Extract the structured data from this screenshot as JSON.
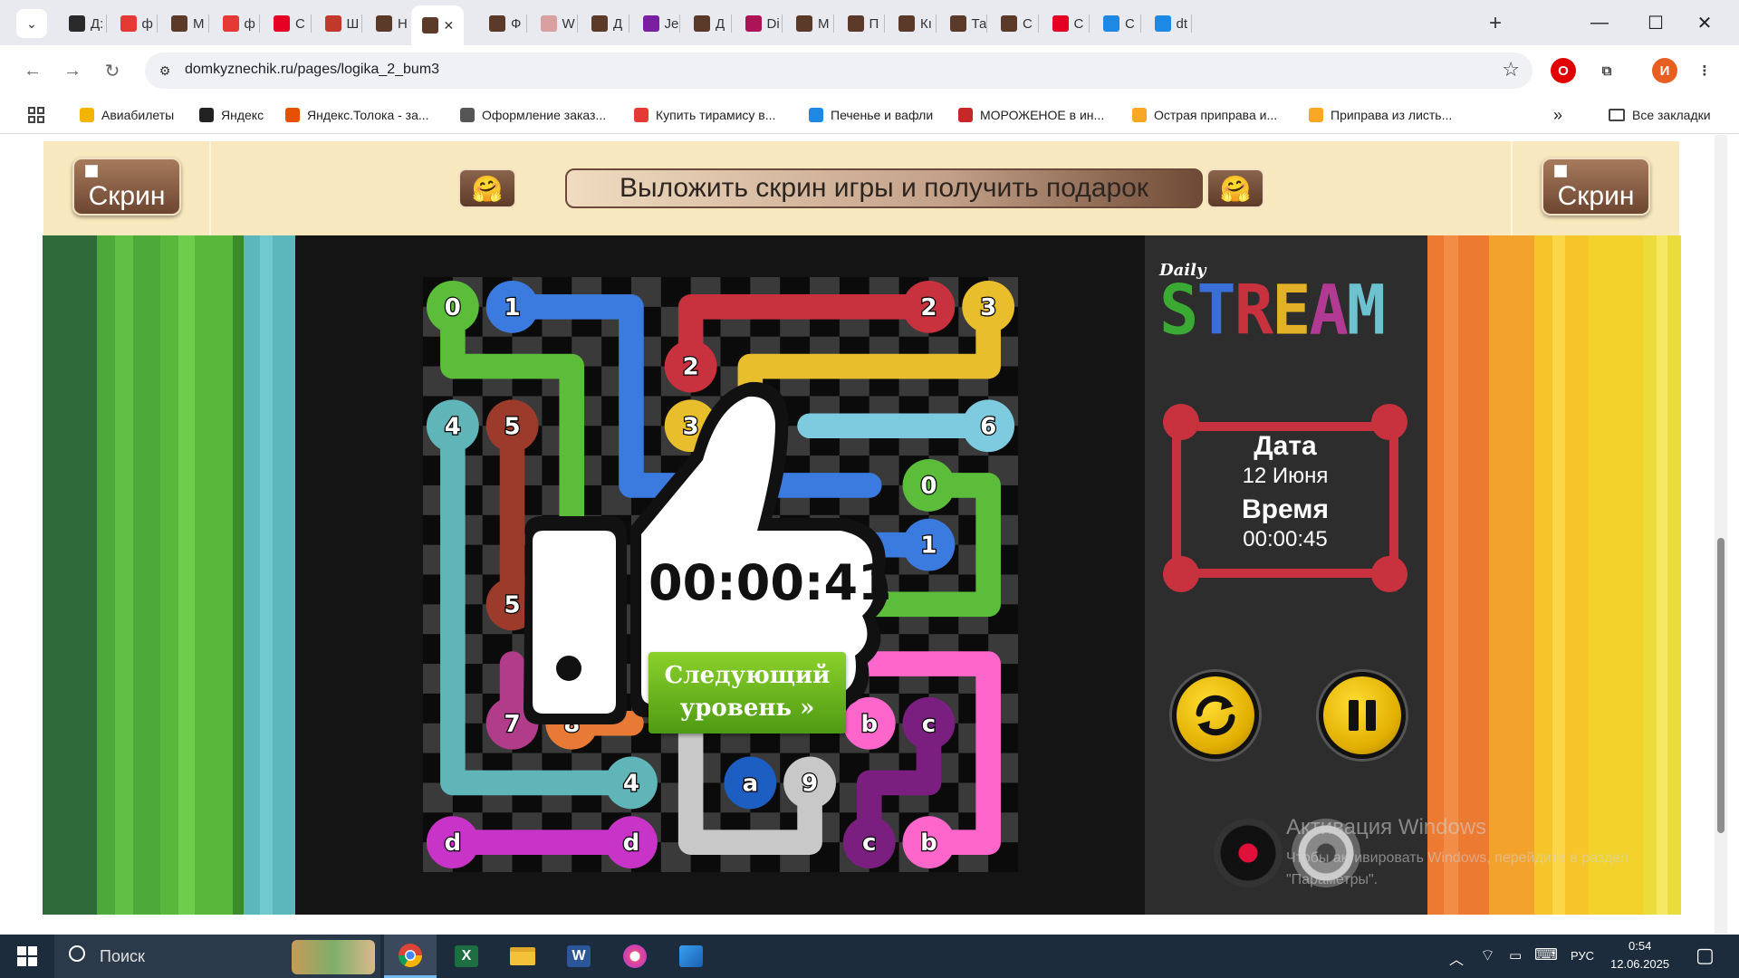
{
  "browser": {
    "tabs": [
      {
        "label": "Д:",
        "color": "#2a2a2a"
      },
      {
        "label": "ф",
        "color": "#e53935"
      },
      {
        "label": "М",
        "color": "#5b3a29"
      },
      {
        "label": "ф",
        "color": "#e53935"
      },
      {
        "label": "С",
        "color": "#e60023"
      },
      {
        "label": "Ш",
        "color": "#c0392b"
      },
      {
        "label": "Н",
        "color": "#5b3a29"
      },
      {
        "label": "",
        "color": "#5b3a29"
      },
      {
        "label": "Ф",
        "color": "#5b3a29"
      },
      {
        "label": "W",
        "color": "#d9a0a0"
      },
      {
        "label": "Д",
        "color": "#5b3a29"
      },
      {
        "label": "Je",
        "color": "#7b1fa2"
      },
      {
        "label": "Д",
        "color": "#5b3a29"
      },
      {
        "label": "Di",
        "color": "#ad1457"
      },
      {
        "label": "М",
        "color": "#5b3a29"
      },
      {
        "label": "П",
        "color": "#5b3a29"
      },
      {
        "label": "Кı",
        "color": "#5b3a29"
      },
      {
        "label": "Та",
        "color": "#5b3a29"
      },
      {
        "label": "С",
        "color": "#5b3a29"
      },
      {
        "label": "С",
        "color": "#e60023"
      },
      {
        "label": "С",
        "color": "#1e88e5"
      },
      {
        "label": "dt",
        "color": "#1e88e5"
      }
    ],
    "active_tab_close": "✕",
    "new_tab": "+",
    "url": "domkyznechik.ru/pages/logika_2_bum3",
    "bookmarks": [
      {
        "label": "Авиабилеты",
        "color": "#f4b400"
      },
      {
        "label": "Яндекс",
        "color": "#222"
      },
      {
        "label": "Яндекс.Толока - за...",
        "color": "#e65100"
      },
      {
        "label": "Оформление заказ...",
        "color": "#555"
      },
      {
        "label": "Купить тирамису в...",
        "color": "#e53935"
      },
      {
        "label": "Печенье и вафли",
        "color": "#1e88e5"
      },
      {
        "label": "МОРОЖЕНОЕ в ин...",
        "color": "#c62828"
      },
      {
        "label": "Острая приправа и...",
        "color": "#f9a825"
      },
      {
        "label": "Приправа из листь...",
        "color": "#f9a825"
      }
    ],
    "bookmarks_more": "»",
    "all_bookmarks": "Все закладки"
  },
  "banner": {
    "screen_left": "Скрин",
    "screen_right": "Скрин",
    "emoji_left": "🤗",
    "emoji_right": "🤗",
    "text": "Выложить скрин игры и получить подарок"
  },
  "game": {
    "logo_small": "Daily",
    "logo_letters": [
      {
        "ch": "S",
        "color": "#3aaa35"
      },
      {
        "ch": "T",
        "color": "#3b6fd8"
      },
      {
        "ch": "R",
        "color": "#c8323e"
      },
      {
        "ch": "E",
        "color": "#e2b127"
      },
      {
        "ch": "A",
        "color": "#b23a93"
      },
      {
        "ch": "M",
        "color": "#6cc2cf"
      }
    ],
    "date_label": "Дата",
    "date_value": "12 Июня",
    "time_label": "Время",
    "time_value": "00:00:45",
    "win_timer": "00:00:41",
    "next_button": "Следующий уровень »",
    "next_line1": "Следующий",
    "next_line2": "уровень »",
    "grid_size": 10,
    "colors": {
      "0": "#5bbd3a",
      "1": "#3b7be0",
      "2": "#c8323e",
      "3": "#e8be2c",
      "4": "#5fb5b8",
      "5": "#9c3a2c",
      "6": "#7ecbe0",
      "7": "#b03c8a",
      "8": "#e87a35",
      "9": "#c8c8c8",
      "a": "#1d5ec2",
      "b": "#ff66cc",
      "c": "#7a1f80",
      "d": "#c833c8"
    },
    "dots": [
      {
        "id": "0",
        "r": 0,
        "c": 0
      },
      {
        "id": "1",
        "r": 0,
        "c": 1
      },
      {
        "id": "2",
        "r": 0,
        "c": 8
      },
      {
        "id": "3",
        "r": 0,
        "c": 9
      },
      {
        "id": "2",
        "r": 1,
        "c": 4
      },
      {
        "id": "4",
        "r": 2,
        "c": 0
      },
      {
        "id": "5",
        "r": 2,
        "c": 1
      },
      {
        "id": "3",
        "r": 2,
        "c": 4
      },
      {
        "id": "6",
        "r": 2,
        "c": 9
      },
      {
        "id": "0",
        "r": 3,
        "c": 8
      },
      {
        "id": "1",
        "r": 4,
        "c": 8
      },
      {
        "id": "5",
        "r": 5,
        "c": 1
      },
      {
        "id": "7",
        "r": 7,
        "c": 1
      },
      {
        "id": "8",
        "r": 7,
        "c": 2
      },
      {
        "id": "b",
        "r": 7,
        "c": 7
      },
      {
        "id": "c",
        "r": 7,
        "c": 8
      },
      {
        "id": "4",
        "r": 8,
        "c": 3
      },
      {
        "id": "a",
        "r": 8,
        "c": 5
      },
      {
        "id": "9",
        "r": 8,
        "c": 6
      },
      {
        "id": "d",
        "r": 9,
        "c": 0
      },
      {
        "id": "d",
        "r": 9,
        "c": 3
      },
      {
        "id": "c",
        "r": 9,
        "c": 7
      },
      {
        "id": "b",
        "r": 9,
        "c": 8
      }
    ],
    "paths": [
      {
        "id": "0",
        "cells": [
          [
            0,
            0
          ],
          [
            1,
            0
          ],
          [
            1,
            2
          ],
          [
            3,
            2
          ],
          [
            4,
            2
          ]
        ]
      },
      {
        "id": "1",
        "cells": [
          [
            0,
            1
          ],
          [
            0,
            3
          ],
          [
            3,
            3
          ],
          [
            3,
            5
          ],
          [
            3,
            7
          ]
        ]
      },
      {
        "id": "2",
        "cells": [
          [
            1,
            4
          ],
          [
            0,
            4
          ],
          [
            0,
            8
          ]
        ]
      },
      {
        "id": "3",
        "cells": [
          [
            0,
            9
          ],
          [
            1,
            9
          ],
          [
            1,
            5
          ],
          [
            2,
            5
          ],
          [
            2,
            4
          ]
        ]
      },
      {
        "id": "4",
        "cells": [
          [
            2,
            0
          ],
          [
            8,
            0
          ],
          [
            8,
            3
          ]
        ]
      },
      {
        "id": "5",
        "cells": [
          [
            2,
            1
          ],
          [
            5,
            1
          ]
        ]
      },
      {
        "id": "6",
        "cells": [
          [
            2,
            9
          ],
          [
            2,
            6
          ]
        ]
      },
      {
        "id": "0",
        "cells": [
          [
            3,
            8
          ],
          [
            3,
            9
          ],
          [
            5,
            9
          ],
          [
            5,
            7
          ]
        ]
      },
      {
        "id": "1",
        "cells": [
          [
            4,
            8
          ],
          [
            4,
            7
          ]
        ]
      },
      {
        "id": "b",
        "cells": [
          [
            6,
            7
          ],
          [
            6,
            9
          ],
          [
            9,
            9
          ],
          [
            9,
            8
          ]
        ]
      },
      {
        "id": "c",
        "cells": [
          [
            7,
            8
          ],
          [
            8,
            8
          ],
          [
            8,
            7
          ],
          [
            9,
            7
          ]
        ]
      },
      {
        "id": "9",
        "cells": [
          [
            7,
            4
          ],
          [
            9,
            4
          ],
          [
            9,
            6
          ],
          [
            8,
            6
          ]
        ]
      },
      {
        "id": "d",
        "cells": [
          [
            9,
            0
          ],
          [
            9,
            3
          ]
        ]
      },
      {
        "id": "7",
        "cells": [
          [
            6,
            1
          ],
          [
            7,
            1
          ]
        ]
      },
      {
        "id": "8",
        "cells": [
          [
            7,
            2
          ],
          [
            7,
            3
          ]
        ]
      }
    ]
  },
  "watermark": {
    "title": "Активация Windows",
    "subtitle": "Чтобы активировать Windows, перейдите в раздел \"Параметры\"."
  },
  "taskbar": {
    "search": "Поиск",
    "lang": "РУС",
    "time": "0:54",
    "date": "12.06.2025"
  }
}
